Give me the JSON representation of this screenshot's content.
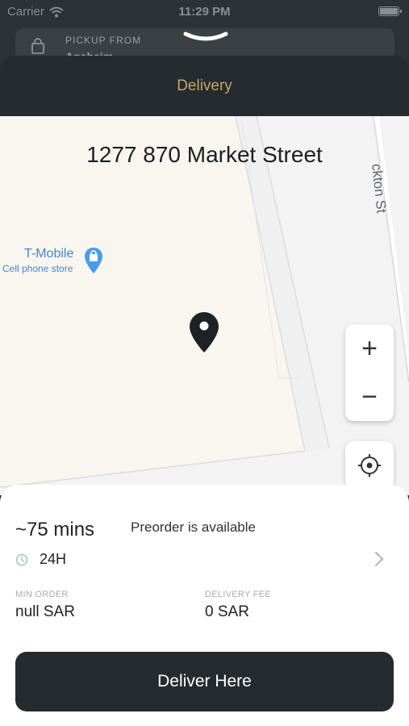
{
  "status_bar": {
    "carrier": "Carrier",
    "time": "11:29 PM"
  },
  "pickup": {
    "label": "PICKUP FROM",
    "value": "Anaheim..."
  },
  "sheet": {
    "title": "Delivery"
  },
  "map": {
    "address": "1277 870 Market Street",
    "street_label": "ckton St",
    "poi": {
      "name": "T-Mobile",
      "category": "Cell phone store"
    },
    "zoom_in": "+",
    "zoom_out": "−"
  },
  "info": {
    "eta": "~75 mins",
    "preorder": "Preorder is available",
    "hours": "24H",
    "min_order_label": "MIN ORDER",
    "min_order_value": "null SAR",
    "delivery_fee_label": "DELIVERY FEE",
    "delivery_fee_value": "0 SAR"
  },
  "action": {
    "deliver_label": "Deliver Here"
  },
  "colors": {
    "accent": "#c5a66b",
    "dark": "#252b2f",
    "map_blue": "#4a83d6",
    "clock_green": "#9cc9a4"
  },
  "icons": [
    "wifi-icon",
    "battery-icon",
    "shop-bag-icon",
    "chevron-down-icon",
    "map-pin-icon",
    "shopping-pin-icon",
    "plus-icon",
    "minus-icon",
    "crosshair-icon",
    "clock-icon",
    "chevron-right-icon"
  ]
}
